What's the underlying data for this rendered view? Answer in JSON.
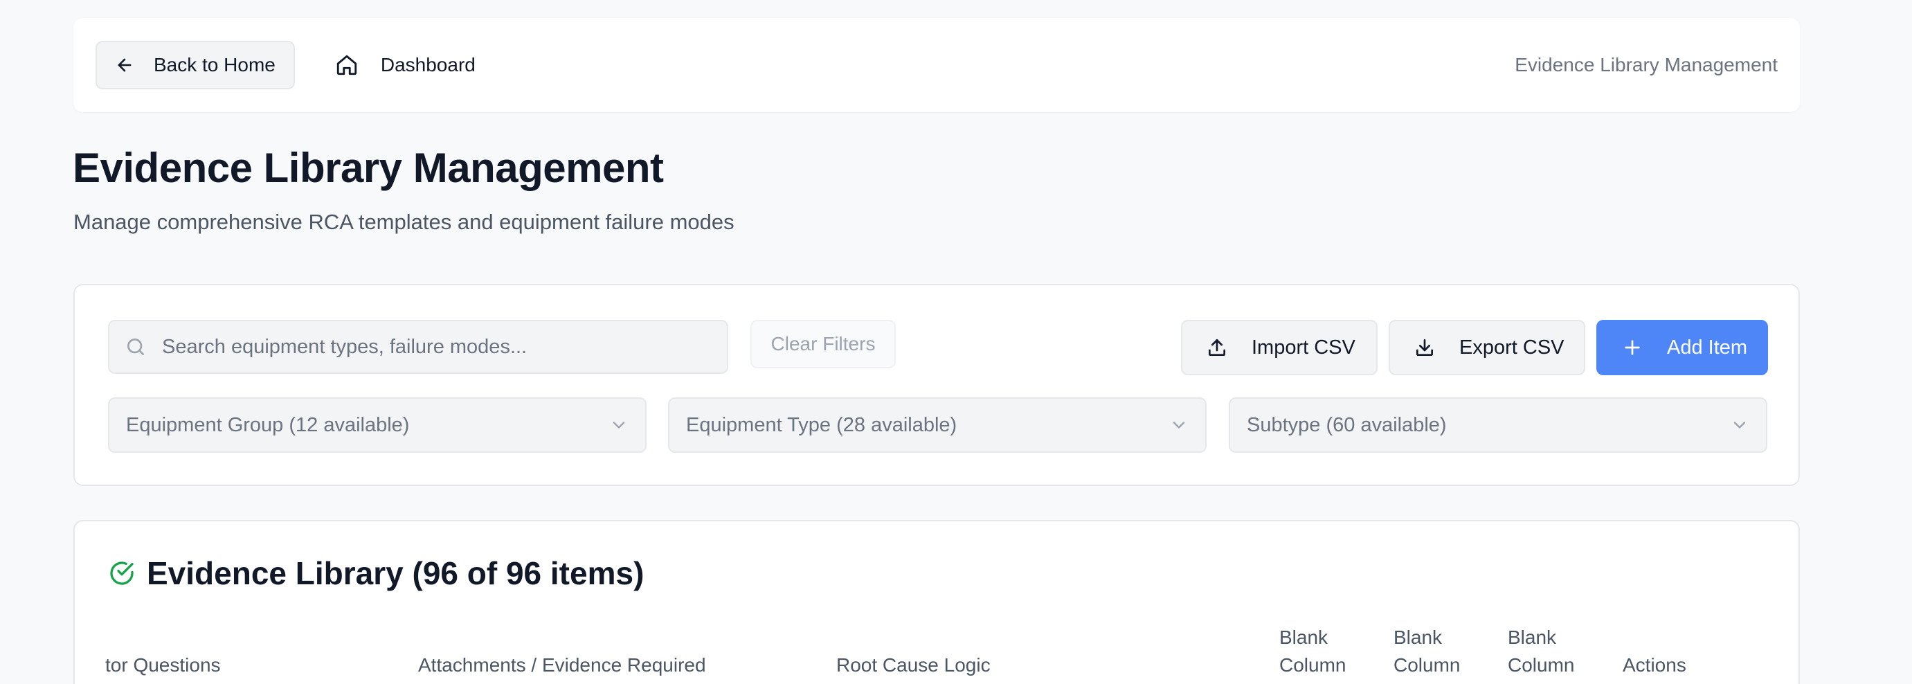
{
  "topbar": {
    "back_label": "Back to Home",
    "dashboard_label": "Dashboard",
    "right_title": "Evidence Library Management"
  },
  "header": {
    "title": "Evidence Library Management",
    "subtitle": "Manage comprehensive RCA templates and equipment failure modes"
  },
  "filters": {
    "search_placeholder": "Search equipment types, failure modes...",
    "clear_label": "Clear Filters",
    "import_label": "Import CSV",
    "export_label": "Export CSV",
    "add_label": "Add Item",
    "equipment_group": "Equipment Group (12 available)",
    "equipment_type": "Equipment Type (28 available)",
    "subtype": "Subtype (60 available)"
  },
  "library": {
    "title": "Evidence Library (96 of 96 items)",
    "columns": [
      "tor Questions",
      "Attachments / Evidence Required",
      "Root Cause Logic",
      "Blank Column",
      "Blank Column",
      "Blank Column",
      "Actions"
    ]
  },
  "colors": {
    "accent": "#4f86f7",
    "success": "#16a34a",
    "background": "#f8f9fb"
  },
  "icons": {
    "back": "arrow-left-icon",
    "dashboard": "home-icon",
    "search": "search-icon",
    "import": "upload-icon",
    "export": "download-icon",
    "add": "plus-icon",
    "dropdown": "chevron-down-icon",
    "library": "check-circle-icon"
  }
}
